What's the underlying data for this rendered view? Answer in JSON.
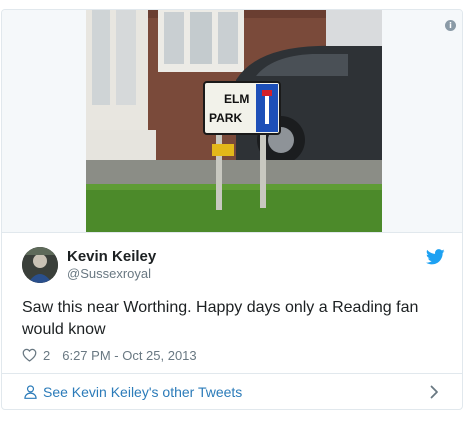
{
  "tweet": {
    "author_name": "Kevin Keiley",
    "author_handle": "@Sussexroyal",
    "text": "Saw this near Worthing. Happy days only a Reading fan would know",
    "like_count": "2",
    "timestamp": "6:27 PM - Oct 25, 2013"
  },
  "media": {
    "sign_text_line1": "ELM",
    "sign_text_line2": "PARK",
    "info_icon": "info-icon"
  },
  "footer": {
    "link_label": "See Kevin Keiley's other Tweets"
  },
  "icons": [
    "info-icon",
    "twitter-bird-icon",
    "heart-icon",
    "person-icon",
    "chevron-right-icon"
  ],
  "colors": {
    "link": "#2b7bb9",
    "twitter_blue": "#1da1f2",
    "text": "#1c2022",
    "muted": "#697882",
    "border": "#e1e8ed"
  }
}
